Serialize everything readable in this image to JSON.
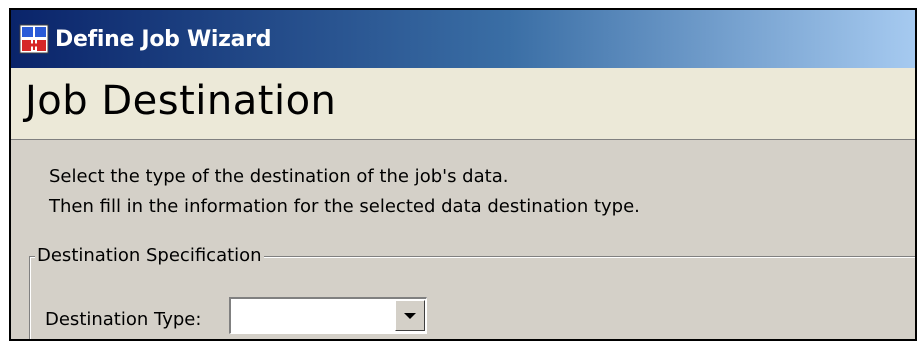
{
  "window": {
    "title": "Define Job Wizard",
    "icon": "wizard-app-icon"
  },
  "page": {
    "title": "Job Destination",
    "description_lines": [
      "Select the type of the destination of the job's data.",
      "Then fill in the information for the selected data destination type."
    ]
  },
  "destination_spec": {
    "group_label": "Destination Specification",
    "type_label": "Destination Type:",
    "type_value": "",
    "dropdown_icon": "chevron-down-icon"
  },
  "colors": {
    "titlebar_start": "#0a246a",
    "titlebar_end": "#a6caf0",
    "dialog_bg": "#d4d0c8",
    "header_bg": "#ece9d8"
  }
}
